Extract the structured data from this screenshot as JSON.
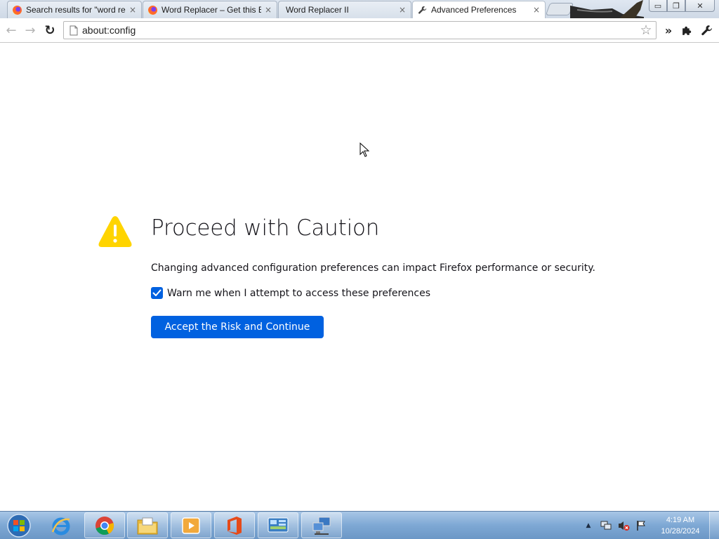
{
  "browser": {
    "tabs": [
      {
        "title": "Search results for \"word rep",
        "favicon": "firefox-icon",
        "close": "×"
      },
      {
        "title": "Word Replacer – Get this Ex",
        "favicon": "firefox-icon",
        "close": "×"
      },
      {
        "title": "Word Replacer II",
        "favicon": "none",
        "close": "×"
      },
      {
        "title": "Advanced Preferences",
        "favicon": "wrench-icon",
        "close": "×",
        "active": true
      }
    ],
    "window_buttons": {
      "minimize": "▭",
      "restore": "❐",
      "close": "✕"
    },
    "toolbar": {
      "back": "←",
      "forward": "→",
      "reload": "↻",
      "url": "about:config",
      "star": "☆",
      "overflow": "»"
    }
  },
  "page": {
    "title": "Proceed with Caution",
    "description": "Changing advanced configuration preferences can impact Firefox performance or security.",
    "checkbox_label": "Warn me when I attempt to access these preferences",
    "checkbox_checked": true,
    "accept_button": "Accept the Risk and Continue"
  },
  "taskbar": {
    "apps": [
      "start-orb",
      "internet-explorer",
      "chrome",
      "file-explorer",
      "media-player",
      "office",
      "control-panel",
      "network-connections"
    ],
    "clock": {
      "time": "4:19 AM",
      "date": "10/28/2024"
    },
    "tray_arrow": "▲"
  },
  "colors": {
    "accent": "#0061e0",
    "warning": "#ffd400",
    "taskbar": "#7ea8d4"
  }
}
